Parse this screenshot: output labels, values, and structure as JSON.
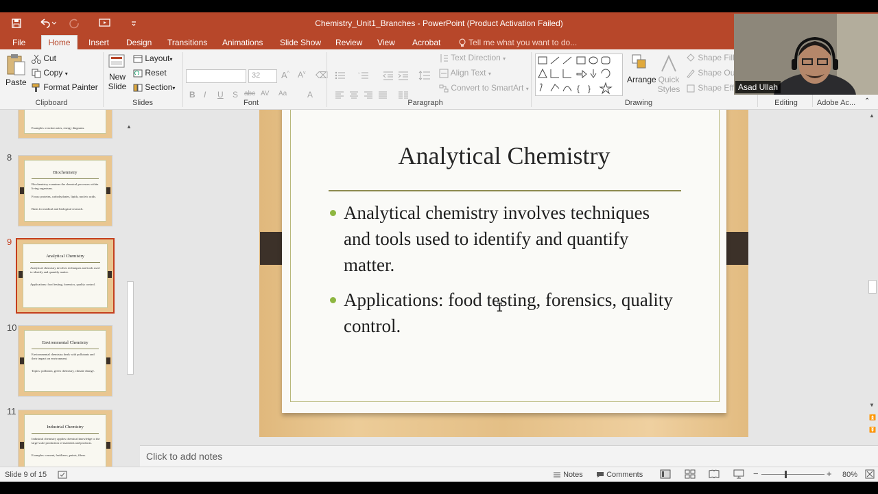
{
  "window": {
    "title": "Chemistry_Unit1_Branches - PowerPoint (Product Activation Failed)"
  },
  "tabs": [
    {
      "label": "File"
    },
    {
      "label": "Home"
    },
    {
      "label": "Insert"
    },
    {
      "label": "Design"
    },
    {
      "label": "Transitions"
    },
    {
      "label": "Animations"
    },
    {
      "label": "Slide Show"
    },
    {
      "label": "Review"
    },
    {
      "label": "View"
    },
    {
      "label": "Acrobat"
    }
  ],
  "tellme": "Tell me what you want to do...",
  "ribbon": {
    "clipboard": {
      "paste": "Paste",
      "cut": "Cut",
      "copy": "Copy",
      "format_painter": "Format Painter",
      "label": "Clipboard"
    },
    "slides": {
      "new_slide_1": "New",
      "new_slide_2": "Slide",
      "layout": "Layout",
      "reset": "Reset",
      "section": "Section",
      "label": "Slides"
    },
    "font": {
      "size": "32",
      "label": "Font"
    },
    "paragraph": {
      "text_direction": "Text Direction",
      "align_text": "Align Text",
      "convert_smartart": "Convert to SmartArt",
      "label": "Paragraph"
    },
    "drawing": {
      "arrange": "Arrange",
      "quick_styles_1": "Quick",
      "quick_styles_2": "Styles",
      "shape_fill": "Shape Fill",
      "shape_outline": "Shape Outl",
      "shape_effects": "Shape Effe",
      "label": "Drawing"
    },
    "editing": {
      "label": "Editing"
    },
    "adobe": {
      "label": "Adobe Ac..."
    }
  },
  "thumbnails": [
    {
      "num": "8",
      "title": "Biochemistry",
      "bullets": [
        "Biochemistry examines the chemical processes within living organisms.",
        "Focus: proteins, carbohydrates, lipids, nucleic acids.",
        "Basis for medical and biological research."
      ]
    },
    {
      "num": "9",
      "title": "Analytical Chemistry",
      "bullets": [
        "Analytical chemistry involves techniques and tools used to identify and quantify matter.",
        "Applications: food testing, forensics, quality control."
      ]
    },
    {
      "num": "10",
      "title": "Environmental Chemistry",
      "bullets": [
        "Environmental chemistry deals with pollutants and their impact on environment.",
        "Topics: pollution, green chemistry, climate change."
      ]
    },
    {
      "num": "11",
      "title": "Industrial Chemistry",
      "bullets": [
        "Industrial chemistry applies chemical knowledge to the large-scale production of materials and products.",
        "Examples: cement, fertilizers, paints, fibers."
      ]
    }
  ],
  "partial_thumb_text": "Examples: reaction rates, energy diagrams.",
  "slide": {
    "title": "Analytical Chemistry",
    "bullets": [
      "Analytical chemistry involves techniques and tools used to identify and quantify matter.",
      "Applications: food testing, forensics, quality control."
    ]
  },
  "notes_placeholder": "Click to add notes",
  "status": {
    "slide_info": "Slide 9 of 15",
    "notes": "Notes",
    "comments": "Comments",
    "zoom": "80%"
  },
  "webcam": {
    "name": "Asad Ullah"
  },
  "colors": {
    "accent": "#b7472a",
    "selected_thumb": "#c43e1c",
    "bullet": "#8db640"
  }
}
